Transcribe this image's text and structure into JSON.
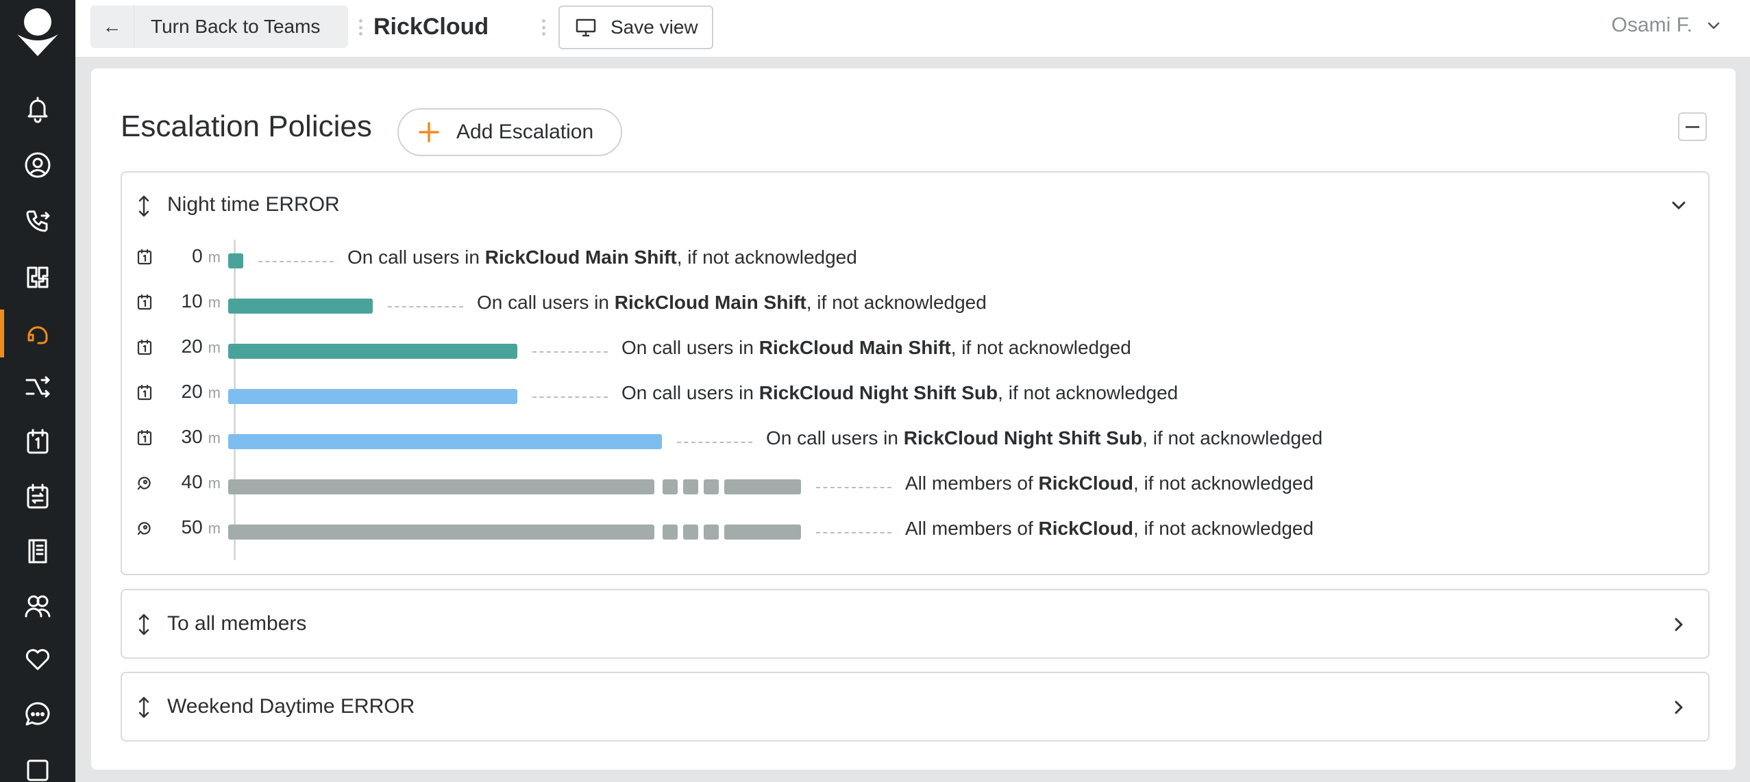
{
  "topbar": {
    "back_label": "Turn Back to Teams",
    "team_name": "RickCloud",
    "save_view_label": "Save view",
    "user_name": "Osami F."
  },
  "sidebar": {
    "items": [
      {
        "icon": "bell-icon"
      },
      {
        "icon": "user-circle-icon"
      },
      {
        "icon": "phone-forward-icon"
      },
      {
        "icon": "integrations-icon"
      },
      {
        "icon": "headset-icon",
        "active": true
      },
      {
        "icon": "routing-icon"
      },
      {
        "icon": "calendar-icon"
      },
      {
        "icon": "rotation-icon"
      },
      {
        "icon": "book-icon"
      },
      {
        "icon": "team-icon"
      },
      {
        "icon": "heart-icon"
      },
      {
        "icon": "chat-icon"
      },
      {
        "icon": "stats-icon"
      }
    ]
  },
  "main": {
    "section_title": "Escalation Policies",
    "add_escalation_label": "Add Escalation",
    "policies": [
      {
        "name": "Night time ERROR",
        "expanded": true,
        "steps": [
          {
            "minutes": "0",
            "unit": "m",
            "prefix": "On call users in ",
            "target": "RickCloud Main Shift",
            "suffix": ", if not acknowledged",
            "kind": "schedule",
            "color": "#4aa39a"
          },
          {
            "minutes": "10",
            "unit": "m",
            "prefix": "On call users in ",
            "target": "RickCloud Main Shift",
            "suffix": ", if not acknowledged",
            "kind": "schedule",
            "color": "#4aa39a"
          },
          {
            "minutes": "20",
            "unit": "m",
            "prefix": "On call users in ",
            "target": "RickCloud Main Shift",
            "suffix": ", if not acknowledged",
            "kind": "schedule",
            "color": "#4aa39a"
          },
          {
            "minutes": "20",
            "unit": "m",
            "prefix": "On call users in ",
            "target": "RickCloud Night Shift Sub",
            "suffix": ", if not acknowledged",
            "kind": "schedule",
            "color": "#7dbdf0"
          },
          {
            "minutes": "30",
            "unit": "m",
            "prefix": "On call users in ",
            "target": "RickCloud Night Shift Sub",
            "suffix": ", if not acknowledged",
            "kind": "schedule",
            "color": "#7dbdf0"
          },
          {
            "minutes": "40",
            "unit": "m",
            "prefix": "All members of ",
            "target": "RickCloud",
            "suffix": ", if not acknowledged",
            "kind": "team",
            "color": "#a3abab"
          },
          {
            "minutes": "50",
            "unit": "m",
            "prefix": "All members of ",
            "target": "RickCloud",
            "suffix": ", if not acknowledged",
            "kind": "team",
            "color": "#a3abab"
          }
        ]
      },
      {
        "name": "To all members",
        "expanded": false
      },
      {
        "name": "Weekend Daytime ERROR",
        "expanded": false
      }
    ]
  },
  "colors": {
    "accent": "#f08c1c",
    "sidebar_bg": "#1d2123",
    "main_shift": "#4aa39a",
    "night_shift": "#7dbdf0",
    "team": "#a3abab"
  }
}
